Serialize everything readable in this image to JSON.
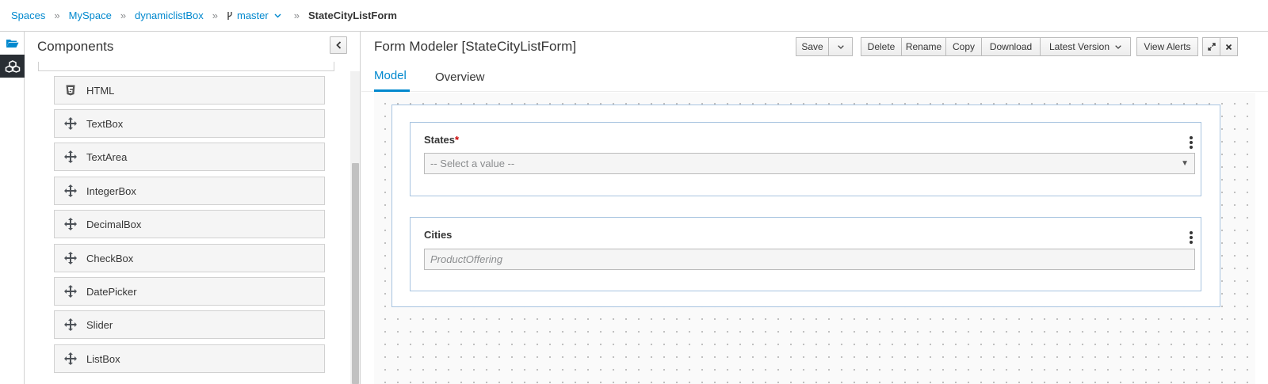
{
  "breadcrumb": {
    "items": [
      "Spaces",
      "MySpace",
      "dynamiclistBox"
    ],
    "separator": "»",
    "branch": "master",
    "current": "StateCityListForm"
  },
  "rail": {
    "items": [
      {
        "icon": "folder-open-icon",
        "active": false
      },
      {
        "icon": "cubes-icon",
        "active": true
      }
    ]
  },
  "components_panel": {
    "title": "Components",
    "items": [
      {
        "label": "HTML",
        "icon": "html5-icon"
      },
      {
        "label": "TextBox",
        "icon": "move-icon"
      },
      {
        "label": "TextArea",
        "icon": "move-icon"
      },
      {
        "label": "IntegerBox",
        "icon": "move-icon"
      },
      {
        "label": "DecimalBox",
        "icon": "move-icon"
      },
      {
        "label": "CheckBox",
        "icon": "move-icon"
      },
      {
        "label": "DatePicker",
        "icon": "move-icon"
      },
      {
        "label": "Slider",
        "icon": "move-icon"
      },
      {
        "label": "ListBox",
        "icon": "move-icon"
      }
    ]
  },
  "main": {
    "title": "Form Modeler [StateCityListForm]",
    "toolbar": {
      "save": "Save",
      "delete": "Delete",
      "rename": "Rename",
      "copy": "Copy",
      "download": "Download",
      "latest_version": "Latest Version",
      "view_alerts": "View Alerts"
    },
    "tabs": [
      {
        "label": "Model",
        "active": true
      },
      {
        "label": "Overview",
        "active": false
      }
    ],
    "form": {
      "fields": [
        {
          "label": "States",
          "required": true,
          "value": "-- Select a value --",
          "type": "select"
        },
        {
          "label": "Cities",
          "required": false,
          "value": "ProductOffering",
          "type": "text"
        }
      ]
    }
  },
  "colors": {
    "accent": "#0088ce",
    "rail_active": "#292e34",
    "required": "#cc0000",
    "field_border": "#a8c4e0"
  }
}
